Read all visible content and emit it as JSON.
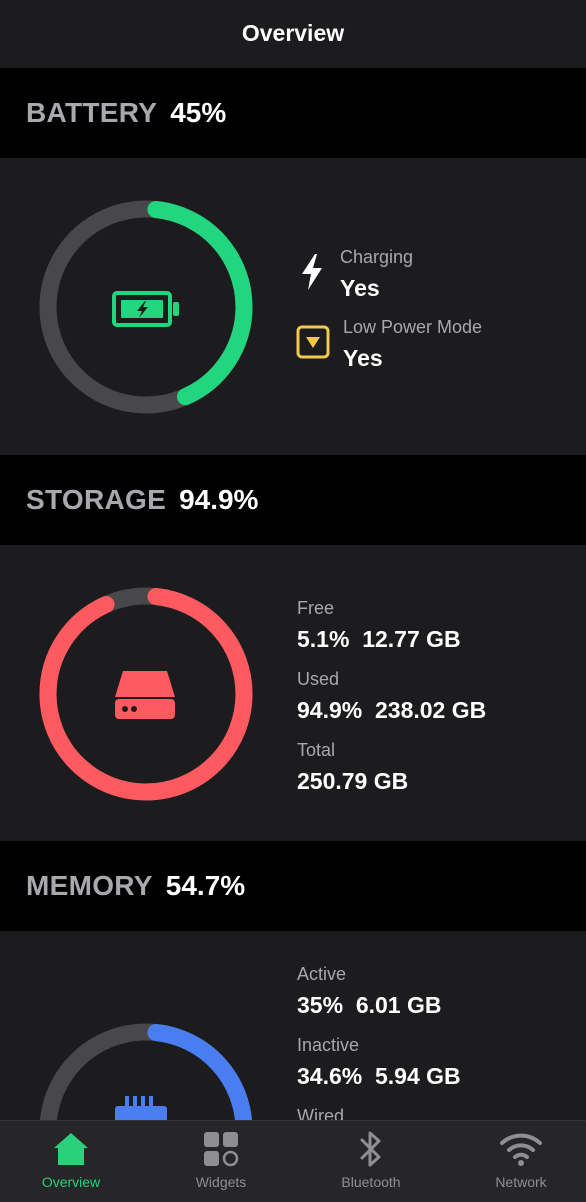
{
  "nav": {
    "title": "Overview"
  },
  "battery": {
    "name": "BATTERY",
    "value": "45%",
    "level": 0.45,
    "charging_label": "Charging",
    "charging_value": "Yes",
    "low_power_label": "Low Power Mode",
    "low_power_value": "Yes",
    "color": "#22d67f"
  },
  "storage": {
    "name": "STORAGE",
    "value": "94.9%",
    "level": 0.949,
    "free_label": "Free",
    "free_value": "5.1%  12.77 GB",
    "used_label": "Used",
    "used_value": "94.9%  238.02 GB",
    "total_label": "Total",
    "total_value": "250.79 GB",
    "color": "#ff5a5f"
  },
  "memory": {
    "name": "MEMORY",
    "value": "54.7%",
    "level": 0.35,
    "active_label": "Active",
    "active_value": "35%  6.01 GB",
    "inactive_label": "Inactive",
    "inactive_value": "34.6%  5.94 GB",
    "wired_label": "Wired",
    "color": "#4a7ef0"
  },
  "tabs": [
    {
      "label": "Overview",
      "icon": "house-icon",
      "active": true
    },
    {
      "label": "Widgets",
      "icon": "widgets-icon",
      "active": false
    },
    {
      "label": "Bluetooth",
      "icon": "bluetooth-icon",
      "active": false
    },
    {
      "label": "Network",
      "icon": "wifi-icon",
      "active": false
    }
  ]
}
